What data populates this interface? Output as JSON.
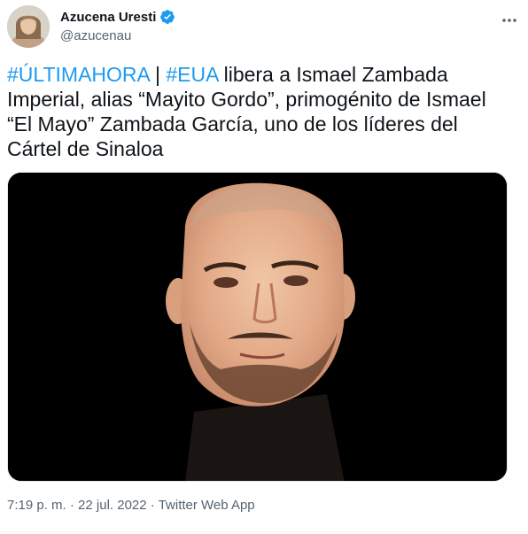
{
  "author": {
    "display_name": "Azucena Uresti",
    "handle": "@azucenau",
    "verified_icon": "verified-badge-icon",
    "avatar_icon": "profile-photo"
  },
  "more_icon": "more-options-icon",
  "tweet": {
    "hashtag_1": "#ÚLTIMAHORA",
    "separator": " | ",
    "hashtag_2": "#EUA",
    "body": " libera a Ismael Zambada Imperial, alias “Mayito Gordo”, primogénito de Ismael “El Mayo” Zambada García, uno de los líderes del Cártel de Sinaloa"
  },
  "media": {
    "icon": "tweet-photo"
  },
  "meta": {
    "time": "7:19 p. m.",
    "sep1": " · ",
    "date": "22 jul. 2022",
    "sep2": " · ",
    "source": "Twitter Web App"
  },
  "colors": {
    "accent": "#1d9bf0",
    "text": "#0f1419",
    "secondary": "#536471"
  }
}
